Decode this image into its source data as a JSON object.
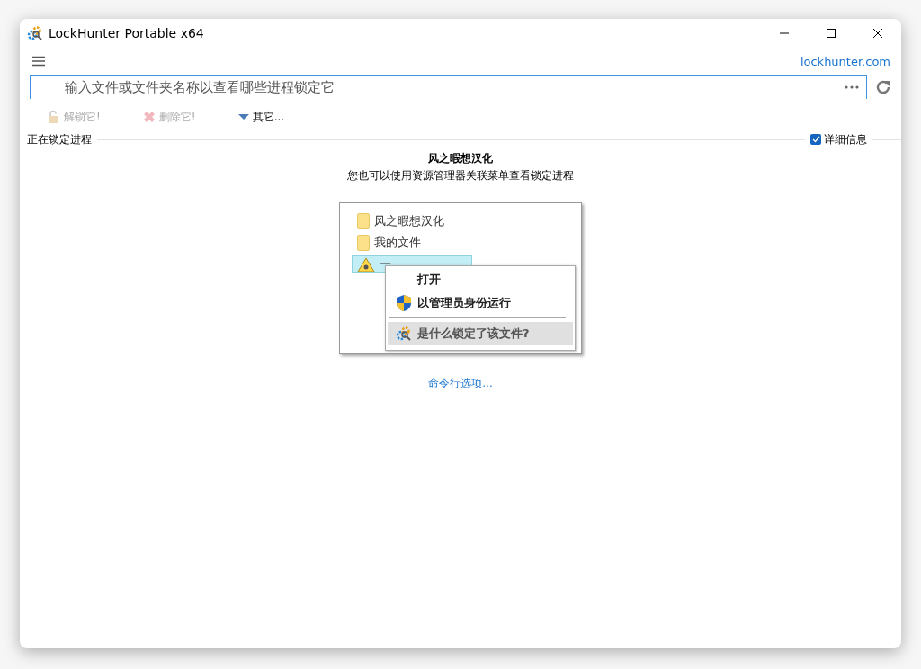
{
  "window": {
    "title": "LockHunter Portable x64"
  },
  "header": {
    "link": "lockhunter.com"
  },
  "search": {
    "placeholder": "输入文件或文件夹名称以查看哪些进程锁定它"
  },
  "toolbar": [
    {
      "label": "解锁它!",
      "kind": "unlock",
      "disabled": true
    },
    {
      "label": "删除它!",
      "kind": "delete",
      "disabled": true
    },
    {
      "label": "其它...",
      "kind": "other",
      "disabled": false
    }
  ],
  "section": {
    "title": "正在锁定进程",
    "details": {
      "label": "详细信息",
      "checked": true
    }
  },
  "info": {
    "title": "风之暇想汉化",
    "subtitle": "您也可以使用资源管理器关联菜单查看锁定进程"
  },
  "illustration": {
    "files": [
      {
        "name": "风之暇想汉化",
        "kind": "folder",
        "selected": false
      },
      {
        "name": "我的文件",
        "kind": "folder",
        "selected": false
      },
      {
        "name": "一",
        "kind": "hazard",
        "selected": true
      }
    ],
    "menu": [
      {
        "label": "打开",
        "kind": "plain",
        "selected": false
      },
      {
        "label": "以管理员身份运行",
        "kind": "shield",
        "selected": false
      },
      {
        "kind": "separator"
      },
      {
        "label": "是什么锁定了该文件?",
        "kind": "lockhunter",
        "selected": true
      }
    ]
  },
  "command_link": "命令行选项..."
}
